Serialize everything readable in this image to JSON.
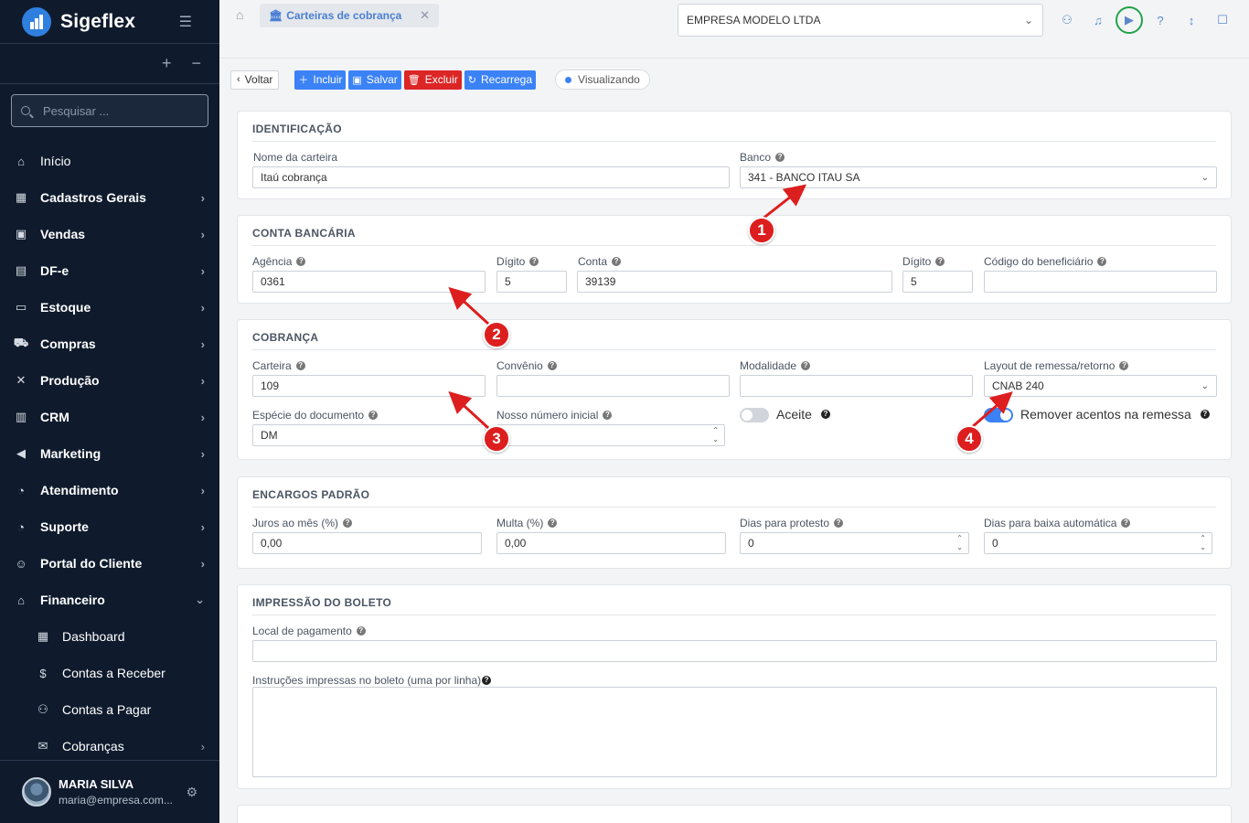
{
  "sidebar": {
    "brand": "Sigeflex",
    "search_placeholder": "Pesquisar ...",
    "items": [
      {
        "label": "Início",
        "icon": "home-icon",
        "glyph": "⌂"
      },
      {
        "label": "Cadastros Gerais",
        "icon": "grid-icon",
        "glyph": "▦"
      },
      {
        "label": "Vendas",
        "icon": "bag-icon",
        "glyph": "▣"
      },
      {
        "label": "DF-e",
        "icon": "document-icon",
        "glyph": "▤"
      },
      {
        "label": "Estoque",
        "icon": "box-icon",
        "glyph": "▭"
      },
      {
        "label": "Compras",
        "icon": "truck-icon",
        "glyph": "⛟"
      },
      {
        "label": "Produção",
        "icon": "tools-icon",
        "glyph": "✕"
      },
      {
        "label": "CRM",
        "icon": "briefcase-icon",
        "glyph": "▥"
      },
      {
        "label": "Marketing",
        "icon": "megaphone-icon",
        "glyph": "◀"
      },
      {
        "label": "Atendimento",
        "icon": "headset-icon",
        "glyph": "◔"
      },
      {
        "label": "Suporte",
        "icon": "headset-icon",
        "glyph": "◔"
      },
      {
        "label": "Portal do Cliente",
        "icon": "user-icon",
        "glyph": "☺"
      },
      {
        "label": "Financeiro",
        "icon": "bank-icon",
        "glyph": "⌂"
      }
    ],
    "sub_items": [
      {
        "label": "Dashboard",
        "icon": "dashboard-icon",
        "glyph": "▦"
      },
      {
        "label": "Contas a Receber",
        "icon": "coin-icon",
        "glyph": "$"
      },
      {
        "label": "Contas a Pagar",
        "icon": "payment-icon",
        "glyph": "⚇"
      },
      {
        "label": "Cobranças",
        "icon": "envelope-icon",
        "glyph": "✉"
      }
    ],
    "user": {
      "name": "MARIA SILVA",
      "email": "maria@empresa.com..."
    }
  },
  "topbar": {
    "tab_label": "Carteiras de cobrança",
    "company": "EMPRESA MODELO LTDA"
  },
  "toolbar": {
    "back": "Voltar",
    "add": "Incluir",
    "save": "Salvar",
    "delete": "Excluir",
    "reload": "Recarrega",
    "status": "Visualizando"
  },
  "sections": {
    "identificacao": {
      "title": "IDENTIFICAÇÃO",
      "nome_label": "Nome da carteira",
      "nome_value": "Itaú cobrança",
      "banco_label": "Banco",
      "banco_value": "341 - BANCO ITAU SA"
    },
    "conta": {
      "title": "CONTA BANCÁRIA",
      "agencia_label": "Agência",
      "agencia_value": "0361",
      "digito1_label": "Dígito",
      "digito1_value": "5",
      "conta_label": "Conta",
      "conta_value": "39139",
      "digito2_label": "Dígito",
      "digito2_value": "5",
      "beneficiario_label": "Código do beneficiário",
      "beneficiario_value": ""
    },
    "cobranca": {
      "title": "COBRANÇA",
      "carteira_label": "Carteira",
      "carteira_value": "109",
      "convenio_label": "Convênio",
      "convenio_value": "",
      "modalidade_label": "Modalidade",
      "modalidade_value": "",
      "layout_label": "Layout de remessa/retorno",
      "layout_value": "CNAB 240",
      "especie_label": "Espécie do documento",
      "especie_value": "DM",
      "nosso_label": "Nosso número inicial",
      "nosso_value": "",
      "aceite_label": "Aceite",
      "aceite_on": false,
      "remover_label": "Remover acentos na remessa",
      "remover_on": true
    },
    "encargos": {
      "title": "ENCARGOS PADRÃO",
      "juros_label": "Juros ao mês (%)",
      "juros_value": "0,00",
      "multa_label": "Multa (%)",
      "multa_value": "0,00",
      "protesto_label": "Dias para protesto",
      "protesto_value": "0",
      "baixa_label": "Dias para baixa automática",
      "baixa_value": "0"
    },
    "impressao": {
      "title": "IMPRESSÃO DO BOLETO",
      "local_label": "Local de pagamento",
      "local_value": "",
      "instrucoes_label": "Instruções impressas no boleto (uma por linha)",
      "instrucoes_value": ""
    }
  },
  "markers": [
    "1",
    "2",
    "3",
    "4"
  ],
  "colors": {
    "sidebar_bg": "#0f1b2d",
    "accent": "#3b82f6",
    "danger": "#dc2626",
    "marker": "#dd1e1e",
    "highlight_ring": "#22a34a"
  }
}
